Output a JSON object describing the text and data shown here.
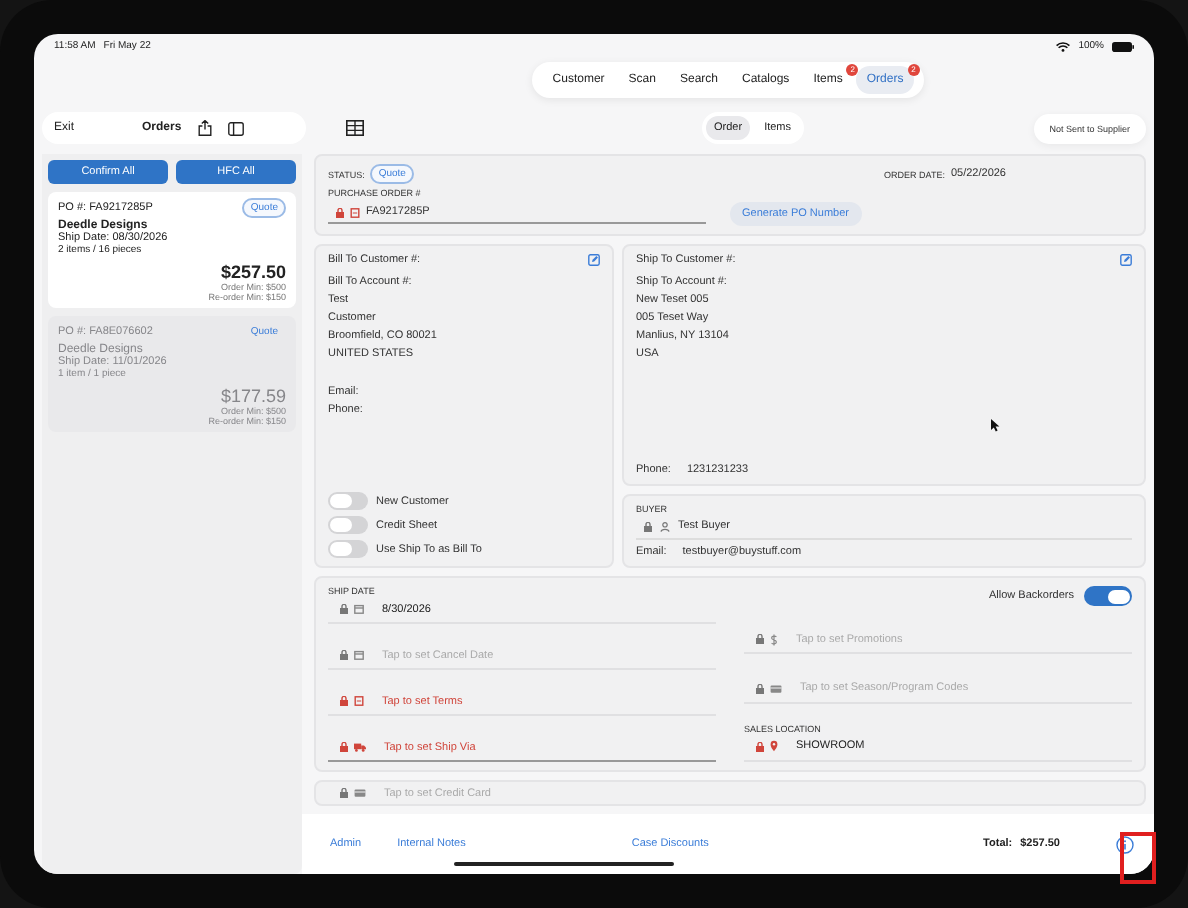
{
  "status_bar": {
    "time": "11:58 AM",
    "date": "Fri May 22",
    "battery": "100%"
  },
  "top_tabs": [
    {
      "label": "Customer",
      "selected": false
    },
    {
      "label": "Scan",
      "selected": false
    },
    {
      "label": "Search",
      "selected": false
    },
    {
      "label": "Catalogs",
      "selected": false
    },
    {
      "label": "Items",
      "selected": false,
      "badge": "2"
    },
    {
      "label": "Orders",
      "selected": true,
      "badge": "2"
    }
  ],
  "toolbar": {
    "exit": "Exit",
    "title": "Orders",
    "segments": [
      {
        "label": "Order",
        "selected": true
      },
      {
        "label": "Items",
        "selected": false
      }
    ],
    "supplier_button": "Not Sent to Supplier"
  },
  "sidebar": {
    "buttons": [
      "Confirm All",
      "HFC All"
    ],
    "orders": [
      {
        "po": "PO #: FA9217285P",
        "status": "Quote",
        "customer": "Deedle Designs",
        "ship_date": "Ship Date: 08/30/2026",
        "count": "2 items / 16 pieces",
        "total": "$257.50",
        "order_min": "Order Min: $500",
        "reorder_min": "Re-order Min: $150",
        "selected": true
      },
      {
        "po": "PO #: FA8E076602",
        "status": "Quote",
        "customer": "Deedle Designs",
        "ship_date": "Ship Date: 11/01/2026",
        "count": "1 item / 1 piece",
        "total": "$177.59",
        "order_min": "Order Min: $500",
        "reorder_min": "Re-order Min: $150",
        "selected": false
      }
    ]
  },
  "order_header": {
    "status_label": "STATUS:",
    "status": "Quote",
    "order_date_label": "ORDER DATE:",
    "order_date": "05/22/2026",
    "po_label": "PURCHASE ORDER #",
    "po_value": "FA9217285P",
    "generate_button": "Generate PO Number"
  },
  "bill_to": {
    "title": "Bill To Customer #:",
    "lines": [
      "Bill To Account #:",
      "Test",
      "Customer",
      "Broomfield, CO 80021",
      "UNITED STATES"
    ],
    "email_label": "Email:",
    "phone_label": "Phone:",
    "toggles": [
      {
        "label": "New Customer",
        "on": false
      },
      {
        "label": "Credit Sheet",
        "on": false
      },
      {
        "label": "Use Ship To as Bill To",
        "on": false
      }
    ]
  },
  "ship_to": {
    "title": "Ship To Customer #:",
    "lines": [
      "Ship To Account #:",
      "New Teset 005",
      "005 Teset Way",
      "Manlius, NY 13104",
      "USA"
    ],
    "phone_label": "Phone:",
    "phone": "1231231233"
  },
  "buyer": {
    "label": "BUYER",
    "name": "Test Buyer",
    "email_label": "Email:",
    "email": "testbuyer@buystuff.com"
  },
  "shipping": {
    "backorders": {
      "label": "Allow Backorders",
      "on": true
    },
    "left_fields": [
      {
        "label": "SHIP DATE",
        "value": "8/30/2026",
        "required": false
      },
      {
        "placeholder": "Tap to set Cancel Date",
        "required": false
      },
      {
        "placeholder": "Tap to set Terms",
        "required": true
      },
      {
        "placeholder": "Tap to set Ship Via",
        "required": true
      }
    ],
    "right_fields": [
      {
        "placeholder": "Tap to set Promotions",
        "required": false
      },
      {
        "placeholder": "Tap to set Season/Program Codes",
        "required": false
      },
      {
        "label": "SALES LOCATION",
        "value": "SHOWROOM",
        "required": true
      }
    ]
  },
  "payment": {
    "placeholder": "Tap to set Credit Card"
  },
  "bottom_bar": {
    "buttons": [
      "Admin",
      "Internal Notes",
      "Case Discounts"
    ],
    "total_label": "Total:",
    "total": "$257.50"
  }
}
